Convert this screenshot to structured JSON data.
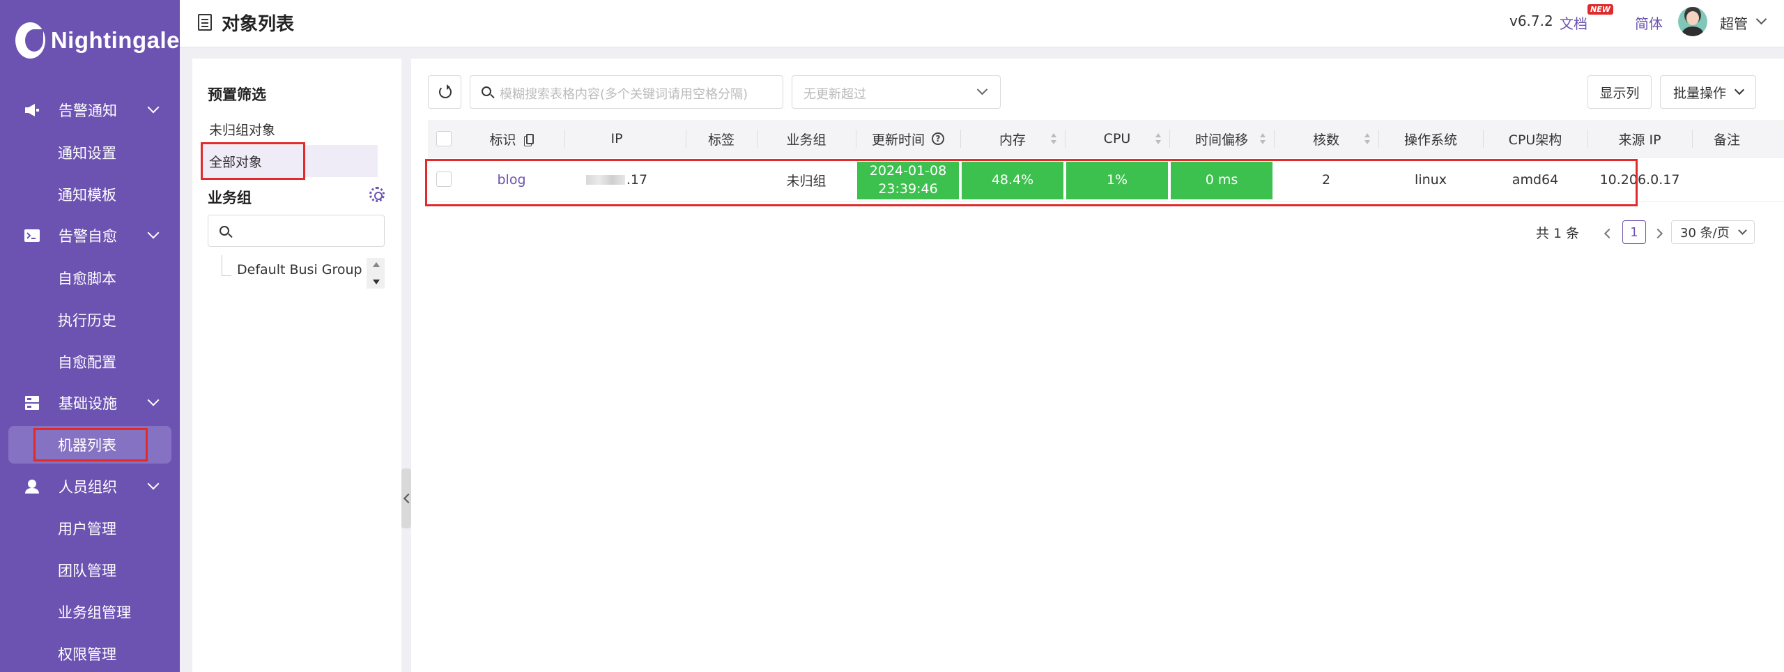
{
  "app": {
    "name": "Nightingale"
  },
  "sidebar": {
    "groups": [
      {
        "label": "告警通知",
        "icon": "megaphone-icon",
        "items": [
          {
            "label": "通知设置"
          },
          {
            "label": "通知模板"
          }
        ]
      },
      {
        "label": "告警自愈",
        "icon": "terminal-icon",
        "items": [
          {
            "label": "自愈脚本"
          },
          {
            "label": "执行历史"
          },
          {
            "label": "自愈配置"
          }
        ]
      },
      {
        "label": "基础设施",
        "icon": "server-icon",
        "items": [
          {
            "label": "机器列表",
            "active": true
          }
        ]
      },
      {
        "label": "人员组织",
        "icon": "user-icon",
        "items": [
          {
            "label": "用户管理"
          },
          {
            "label": "团队管理"
          },
          {
            "label": "业务组管理"
          },
          {
            "label": "权限管理"
          }
        ]
      }
    ]
  },
  "header": {
    "title": "对象列表",
    "version": "v6.7.2",
    "docs": "文档",
    "new_badge": "NEW",
    "language": "简体",
    "user": "超管"
  },
  "filter": {
    "title": "预置筛选",
    "options": [
      {
        "label": "未归组对象"
      },
      {
        "label": "全部对象",
        "active": true
      }
    ],
    "busi_group_title": "业务组",
    "tree": [
      {
        "label": "Default Busi Group"
      }
    ]
  },
  "toolbar": {
    "search_placeholder": "模糊搜索表格内容(多个关键词请用空格分隔)",
    "update_select_placeholder": "无更新超过",
    "columns_button": "显示列",
    "batch_button": "批量操作"
  },
  "table": {
    "columns": {
      "ident": "标识",
      "ip": "IP",
      "tags": "标签",
      "group": "业务组",
      "update_time": "更新时间",
      "mem": "内存",
      "cpu": "CPU",
      "offset": "时间偏移",
      "cores": "核数",
      "os": "操作系统",
      "arch": "CPU架构",
      "source_ip": "来源 IP",
      "note": "备注"
    },
    "row": {
      "ident": "blog",
      "ip_suffix": ".17",
      "tags": "",
      "group": "未归组",
      "update_date": "2024-01-08",
      "update_time": "23:39:46",
      "mem": "48.4%",
      "cpu": "1%",
      "offset": "0 ms",
      "cores": "2",
      "os": "linux",
      "arch": "amd64",
      "source_ip": "10.206.0.17",
      "note": ""
    },
    "status_color": "#3cc04e"
  },
  "pagination": {
    "total": "共 1 条",
    "current_page": "1",
    "page_size": "30 条/页"
  },
  "colors": {
    "brand": "#6c53b1",
    "highlight": "#e02b2b"
  }
}
